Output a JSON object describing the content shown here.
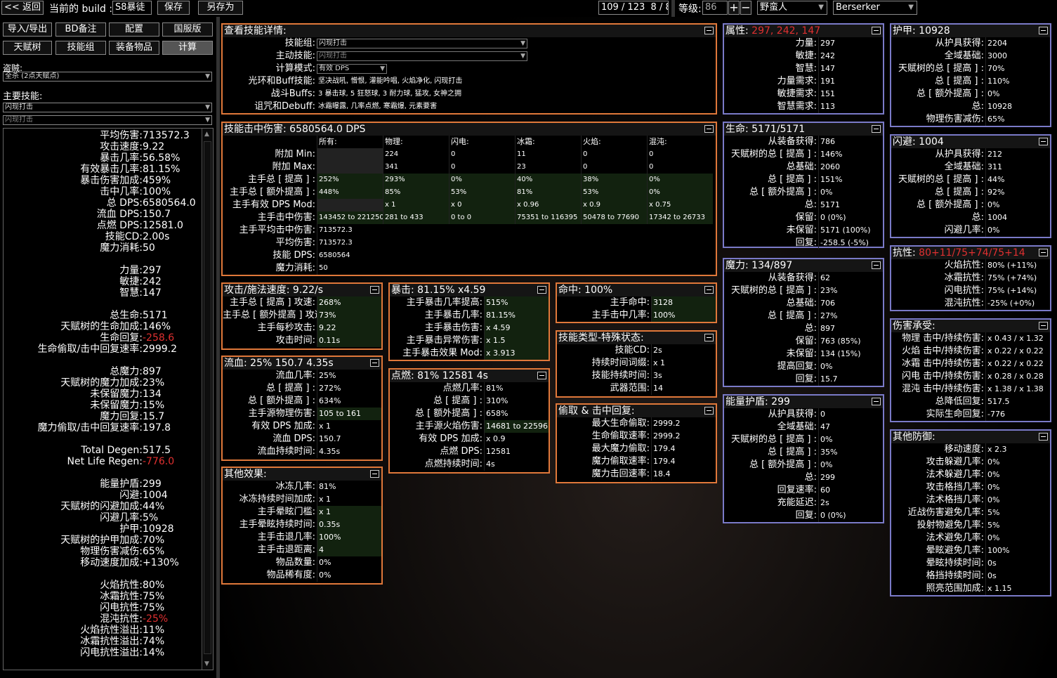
{
  "top": {
    "back": "<< 返回",
    "build_label": "当前的 build :",
    "build_name": "S8暴徒",
    "save": "保存",
    "save_as": "另存为",
    "points": "109 / 123",
    "ascend": "8 / 8",
    "level_label": "等级:",
    "level": "86",
    "class": "野蛮人",
    "ascendancy": "Berserker"
  },
  "nav": {
    "import": "导入/导出",
    "notes": "BD备注",
    "config": "配置",
    "server": "国服版",
    "tree": "天赋树",
    "skills": "技能组",
    "items": "装备物品",
    "calc": "计算"
  },
  "left": {
    "bandit_label": "盗贼:",
    "bandit": "全杀 (2点天赋点)",
    "main_skill_label": "主要技能:",
    "main_skill": "闪现打击",
    "main_skill2": "闪现打击"
  },
  "sidebar": [
    [
      "平均伤害:",
      "713572.3",
      ""
    ],
    [
      "攻击速度:",
      "9.22",
      ""
    ],
    [
      "暴击几率:",
      "56.58%",
      ""
    ],
    [
      "有效暴击几率:",
      "81.15%",
      ""
    ],
    [
      "暴击伤害加成:",
      "459%",
      ""
    ],
    [
      "击中几率:",
      "100%",
      ""
    ],
    [
      "总 DPS:",
      "6580564.0",
      ""
    ],
    [
      "流血 DPS:",
      "150.7",
      ""
    ],
    [
      "点燃 DPS:",
      "12581.0",
      ""
    ],
    [
      "技能CD:",
      "2.00s",
      ""
    ],
    [
      "魔力消耗:",
      "50",
      ""
    ],
    [
      "",
      "",
      ""
    ],
    [
      "力量:",
      "297",
      ""
    ],
    [
      "敏捷:",
      "242",
      ""
    ],
    [
      "智慧:",
      "147",
      ""
    ],
    [
      "",
      "",
      ""
    ],
    [
      "总生命:",
      "5171",
      ""
    ],
    [
      "天赋树的生命加成:",
      "146%",
      ""
    ],
    [
      "生命回复:",
      "-258.6",
      "red"
    ],
    [
      "生命偷取/击中回复速率:",
      "2999.2",
      ""
    ],
    [
      "",
      "",
      ""
    ],
    [
      "总魔力:",
      "897",
      ""
    ],
    [
      "天赋树的魔力加成:",
      "23%",
      ""
    ],
    [
      "未保留魔力:",
      "134",
      ""
    ],
    [
      "未保留魔力:",
      "15%",
      ""
    ],
    [
      "魔力回复:",
      "15.7",
      ""
    ],
    [
      "魔力偷取/击中回复速率:",
      "197.8",
      ""
    ],
    [
      "",
      "",
      ""
    ],
    [
      "Total Degen:",
      "517.5",
      ""
    ],
    [
      "Net Life Regen:",
      "-776.0",
      "red"
    ],
    [
      "",
      "",
      ""
    ],
    [
      "能量护盾:",
      "299",
      ""
    ],
    [
      "闪避:",
      "1004",
      ""
    ],
    [
      "天赋树的闪避加成:",
      "44%",
      ""
    ],
    [
      "闪避几率:",
      "5%",
      ""
    ],
    [
      "护甲:",
      "10928",
      ""
    ],
    [
      "天赋树的护甲加成:",
      "70%",
      ""
    ],
    [
      "物理伤害减伤:",
      "65%",
      ""
    ],
    [
      "移动速度加成:",
      "+130%",
      ""
    ],
    [
      "",
      "",
      ""
    ],
    [
      "火焰抗性:",
      "80%",
      ""
    ],
    [
      "冰霜抗性:",
      "75%",
      ""
    ],
    [
      "闪电抗性:",
      "75%",
      ""
    ],
    [
      "混沌抗性:",
      "-25%",
      "red"
    ],
    [
      "火焰抗性溢出:",
      "11%",
      ""
    ],
    [
      "冰霜抗性溢出:",
      "74%",
      ""
    ],
    [
      "闪电抗性溢出:",
      "14%",
      ""
    ]
  ],
  "skill_detail": {
    "title": "查看技能详情:",
    "rows": [
      [
        "技能组:",
        "闪现打击"
      ],
      [
        "主动技能:",
        "闪现打击"
      ],
      [
        "计算模式:",
        "有效 DPS"
      ],
      [
        "光环和Buff技能:",
        "坚决战吼, 憎恨, 灌能吟唱, 火焰净化, 闪现打击"
      ],
      [
        "战斗Buffs:",
        "3 暴击球, 5 狂怒球, 3 耐力球, 猛攻, 女神之拥"
      ],
      [
        "诅咒和Debuff:",
        "冰霜曝露, 几率点燃, 寒霜爆, 元素要害"
      ]
    ]
  },
  "hit_damage": {
    "title": "技能击中伤害: 6580564.0 DPS",
    "headers": [
      "所有:",
      "物理:",
      "闪电:",
      "冰霜:",
      "火焰:",
      "混沌:"
    ],
    "rows": [
      [
        "附加 Min:",
        "",
        "224",
        "0",
        "11",
        "0",
        "0"
      ],
      [
        "附加 Max:",
        "",
        "341",
        "0",
        "23",
        "0",
        "0"
      ],
      [
        "主手总 [ 提高 ] :",
        "252%",
        "293%",
        "0%",
        "40%",
        "38%",
        "0%"
      ],
      [
        "主手总 [ 额外提高 ] :",
        "448%",
        "85%",
        "53%",
        "81%",
        "53%",
        "0%"
      ],
      [
        "主手有效 DPS Mod:",
        "",
        "x 1",
        "x 0",
        "x 0.96",
        "x 0.9",
        "x 0.75"
      ],
      [
        "主手击中伤害:",
        "143452 to 221250",
        "281 to 433",
        "0 to 0",
        "75351 to 116395",
        "50478 to 77690",
        "17342 to 26733"
      ],
      [
        "主手平均击中伤害:",
        "713572.3",
        "",
        "",
        "",
        "",
        ""
      ],
      [
        "平均伤害:",
        "713572.3",
        "",
        "",
        "",
        "",
        ""
      ],
      [
        "技能 DPS:",
        "6580564",
        "",
        "",
        "",
        "",
        ""
      ],
      [
        "魔力消耗:",
        "50",
        "",
        "",
        "",
        "",
        ""
      ]
    ]
  },
  "speed": {
    "title": "攻击/施法速度: 9.22/s",
    "rows": [
      [
        "主手总 [ 提高 ] 攻速:",
        "268%"
      ],
      [
        "主手总 [ 额外提高 ] 攻速:",
        "73%"
      ],
      [
        "主手每秒攻击:",
        "9.22"
      ],
      [
        "攻击时间:",
        "0.11s"
      ]
    ]
  },
  "crit": {
    "title": "暴击: 81.15% x4.59",
    "rows": [
      [
        "主手暴击几率提高:",
        "515%"
      ],
      [
        "主手暴击几率:",
        "81.15%"
      ],
      [
        "主手暴击伤害:",
        "x 4.59"
      ],
      [
        "主手暴击异常伤害:",
        "x 1.5"
      ],
      [
        "主手暴击效果 Mod:",
        "x 3.913"
      ]
    ]
  },
  "hit": {
    "title": "命中: 100%",
    "rows": [
      [
        "主手命中:",
        "3128"
      ],
      [
        "主手击中几率:",
        "100%"
      ]
    ]
  },
  "bleed": {
    "title": "流血: 25% 150.7 4.35s",
    "rows": [
      [
        "流血几率:",
        "25%"
      ],
      [
        "总 [ 提高 ] :",
        "272%"
      ],
      [
        "总 [ 额外提高 ] :",
        "634%"
      ],
      [
        "主手源物理伤害:",
        "105 to 161"
      ],
      [
        "有效 DPS 加成:",
        "x 1"
      ],
      [
        "流血 DPS:",
        "150.7"
      ],
      [
        "流血持续时间:",
        "4.35s"
      ]
    ]
  },
  "ignite": {
    "title": "点燃: 81% 12581 4s",
    "rows": [
      [
        "点燃几率:",
        "81%"
      ],
      [
        "总 [ 提高 ] :",
        "310%"
      ],
      [
        "总 [ 额外提高 ] :",
        "658%"
      ],
      [
        "主手源火焰伤害:",
        "14681 to 22596"
      ],
      [
        "有效 DPS 加成:",
        "x 0.9"
      ],
      [
        "点燃 DPS:",
        "12581"
      ],
      [
        "点燃持续时间:",
        "4s"
      ]
    ]
  },
  "skilltype": {
    "title": "技能类型-特殊状态:",
    "rows": [
      [
        "技能CD:",
        "2s"
      ],
      [
        "持续时间词缀:",
        "x 1"
      ],
      [
        "技能持续时间:",
        "3s"
      ],
      [
        "武器范围:",
        "14"
      ]
    ]
  },
  "leech": {
    "title": "偷取 & 击中回复:",
    "rows": [
      [
        "最大生命偷取:",
        "2999.2"
      ],
      [
        "生命偷取速率:",
        "2999.2"
      ],
      [
        "最大魔力偷取:",
        "179.4"
      ],
      [
        "魔力偷取速率:",
        "179.4"
      ],
      [
        "魔力击回速率:",
        "18.4"
      ]
    ]
  },
  "other": {
    "title": "其他效果:",
    "rows": [
      [
        "冰冻几率:",
        "81%"
      ],
      [
        "冰冻持续时间加成:",
        "x 1"
      ],
      [
        "主手晕眩门槛:",
        "x 1"
      ],
      [
        "主手晕眩持续时间:",
        "0.35s"
      ],
      [
        "主手击退几率:",
        "100%"
      ],
      [
        "主手击退距离:",
        "4"
      ],
      [
        "物品数量:",
        "0%"
      ],
      [
        "物品稀有度:",
        "0%"
      ]
    ]
  },
  "attr": {
    "title": "属性:",
    "title_val": "297, 242, 147",
    "rows": [
      [
        "力量:",
        "297"
      ],
      [
        "敏捷:",
        "242"
      ],
      [
        "智慧:",
        "147"
      ],
      [
        "力量需求:",
        "191"
      ],
      [
        "敏捷需求:",
        "151"
      ],
      [
        "智慧需求:",
        "113"
      ]
    ]
  },
  "life": {
    "title": "生命: 5171/5171",
    "rows": [
      [
        "从装备获得:",
        "786"
      ],
      [
        "天赋树的总 [ 提高 ] :",
        "146%"
      ],
      [
        "总基础:",
        "2060"
      ],
      [
        "总 [ 提高 ] :",
        "151%"
      ],
      [
        "总 [ 额外提高 ] :",
        "0%"
      ],
      [
        "总:",
        "5171"
      ],
      [
        "保留:",
        "0 (0%)"
      ],
      [
        "未保留:",
        "5171 (100%)"
      ],
      [
        "回复:",
        "-258.5 (-5%)"
      ]
    ]
  },
  "mana": {
    "title": "魔力: 134/897",
    "rows": [
      [
        "从装备获得:",
        "62"
      ],
      [
        "天赋树的总 [ 提高 ] :",
        "23%"
      ],
      [
        "总基础:",
        "706"
      ],
      [
        "总 [ 提高 ] :",
        "27%"
      ],
      [
        "总:",
        "897"
      ],
      [
        "保留:",
        "763 (85%)"
      ],
      [
        "未保留:",
        "134 (15%)"
      ],
      [
        "提高回复:",
        "0%"
      ],
      [
        "回复:",
        "15.7"
      ]
    ]
  },
  "es": {
    "title": "能量护盾: 299",
    "rows": [
      [
        "从护具获得:",
        "0"
      ],
      [
        "全域基础:",
        "47"
      ],
      [
        "天赋树的总 [ 提高 ] :",
        "0%"
      ],
      [
        "总 [ 提高 ] :",
        "35%"
      ],
      [
        "总 [ 额外提高 ] :",
        "0%"
      ],
      [
        "总:",
        "299"
      ],
      [
        "回复速率:",
        "60"
      ],
      [
        "充能延迟:",
        "2s"
      ],
      [
        "回复:",
        "0 (0%)"
      ]
    ]
  },
  "armour": {
    "title": "护甲: 10928",
    "rows": [
      [
        "从护具获得:",
        "2204"
      ],
      [
        "全域基础:",
        "3000"
      ],
      [
        "天赋树的总 [ 提高 ] :",
        "70%"
      ],
      [
        "总 [ 提高 ] :",
        "110%"
      ],
      [
        "总 [ 额外提高 ] :",
        "0%"
      ],
      [
        "总:",
        "10928"
      ],
      [
        "物理伤害减伤:",
        "65%"
      ]
    ]
  },
  "evasion": {
    "title": "闪避: 1004",
    "rows": [
      [
        "从护具获得:",
        "212"
      ],
      [
        "全域基础:",
        "311"
      ],
      [
        "天赋树的总 [ 提高 ] :",
        "44%"
      ],
      [
        "总 [ 提高 ] :",
        "92%"
      ],
      [
        "总 [ 额外提高 ] :",
        "0%"
      ],
      [
        "总:",
        "1004"
      ],
      [
        "闪避几率:",
        "0%"
      ]
    ]
  },
  "resist": {
    "title": "抗性:",
    "title_val": "80+11/75+74/75+14",
    "rows": [
      [
        "火焰抗性:",
        "80% (+11%)"
      ],
      [
        "冰霜抗性:",
        "75% (+74%)"
      ],
      [
        "闪电抗性:",
        "75% (+14%)"
      ],
      [
        "混沌抗性:",
        "-25% (+0%)"
      ]
    ]
  },
  "taken": {
    "title": "伤害承受:",
    "rows": [
      [
        "物理 击中/持续伤害:",
        "x 0.43 / x 1.32"
      ],
      [
        "火焰 击中/持续伤害:",
        "x 0.22 / x 0.22"
      ],
      [
        "冰霜 击中/持续伤害:",
        "x 0.22 / x 0.22"
      ],
      [
        "闪电 击中/持续伤害:",
        "x 0.28 / x 0.28"
      ],
      [
        "混沌 击中/持续伤害:",
        "x 1.38 / x 1.38"
      ],
      [
        "总降低回复:",
        "517.5"
      ],
      [
        "实际生命回复:",
        "-776"
      ]
    ]
  },
  "defense": {
    "title": "其他防御:",
    "rows": [
      [
        "移动速度:",
        "x 2.3"
      ],
      [
        "攻击躲避几率:",
        "0%"
      ],
      [
        "法术躲避几率:",
        "0%"
      ],
      [
        "攻击格挡几率:",
        "0%"
      ],
      [
        "法术格挡几率:",
        "0%"
      ],
      [
        "近战伤害避免几率:",
        "5%"
      ],
      [
        "投射物避免几率:",
        "5%"
      ],
      [
        "法术避免几率:",
        "0%"
      ],
      [
        "晕眩避免几率:",
        "100%"
      ],
      [
        "晕眩持续时间:",
        "0s"
      ],
      [
        "格挡持续时间:",
        "0s"
      ],
      [
        "照亮范围加成:",
        "x 1.15"
      ]
    ]
  },
  "colors": {
    "orange": "#e0783a",
    "blue": "#7a7ac8",
    "red": "#e03030",
    "green_bg": "#12220f"
  }
}
